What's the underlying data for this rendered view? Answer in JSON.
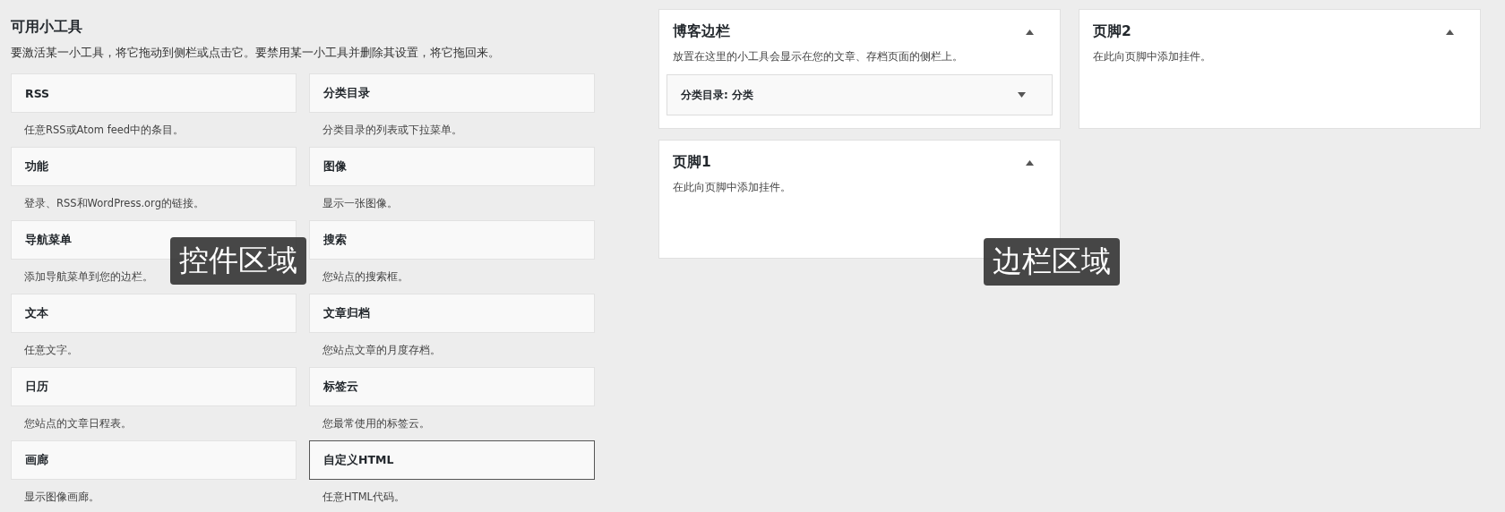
{
  "available_widgets": {
    "title": "可用小工具",
    "description": "要激活某一小工具，将它拖动到侧栏或点击它。要禁用某一小工具并删除其设置，将它拖回来。",
    "widgets": [
      {
        "title": "RSS",
        "description": "任意RSS或Atom feed中的条目。",
        "selected": false
      },
      {
        "title": "分类目录",
        "description": "分类目录的列表或下拉菜单。",
        "selected": false
      },
      {
        "title": "功能",
        "description": "登录、RSS和WordPress.org的链接。",
        "selected": false
      },
      {
        "title": "图像",
        "description": "显示一张图像。",
        "selected": false
      },
      {
        "title": "导航菜单",
        "description": "添加导航菜单到您的边栏。",
        "selected": false
      },
      {
        "title": "搜索",
        "description": "您站点的搜索框。",
        "selected": false
      },
      {
        "title": "文本",
        "description": "任意文字。",
        "selected": false
      },
      {
        "title": "文章归档",
        "description": "您站点文章的月度存档。",
        "selected": false
      },
      {
        "title": "日历",
        "description": "您站点的文章日程表。",
        "selected": false
      },
      {
        "title": "标签云",
        "description": "您最常使用的标签云。",
        "selected": false
      },
      {
        "title": "画廊",
        "description": "显示图像画廊。",
        "selected": false
      },
      {
        "title": "自定义HTML",
        "description": "任意HTML代码。",
        "selected": true
      }
    ]
  },
  "sidebars": [
    {
      "title": "博客边栏",
      "description": "放置在这里的小工具会显示在您的文章、存档页面的侧栏上。",
      "expanded": true,
      "widgets": [
        {
          "title": "分类目录: 分类",
          "expanded": false
        }
      ]
    },
    {
      "title": "页脚2",
      "description": "在此向页脚中添加挂件。",
      "expanded": true
    },
    {
      "title": "页脚1",
      "description": "在此向页脚中添加挂件。",
      "expanded": true
    }
  ],
  "annotations": [
    "控件区域",
    "边栏区域"
  ]
}
